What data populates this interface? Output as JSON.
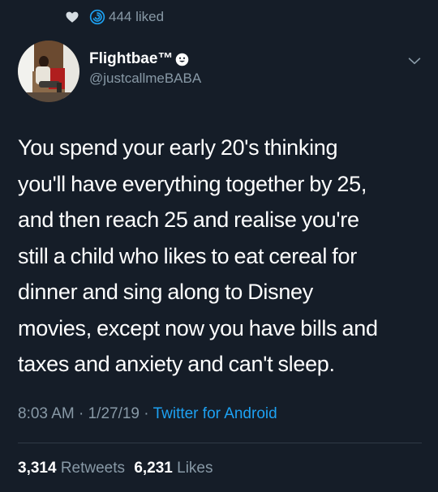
{
  "liked": {
    "count_label": "444 liked",
    "icons": [
      "heart-icon",
      "swirl-icon"
    ]
  },
  "author": {
    "display_name": "Flightbae™",
    "handle": "@justcallmeBABA",
    "avatar_icon": "avatar"
  },
  "tweet": {
    "lines": [
      "You spend your early 20's thinking",
      "you'll have everything together by 25,",
      "and then reach 25 and realise you're",
      "still a child who likes to eat cereal for",
      "dinner and sing along to Disney",
      "movies, except now you have bills and",
      "taxes and anxiety and can't sleep."
    ]
  },
  "meta": {
    "time": "8:03 AM",
    "separator": " · ",
    "date": "1/27/19",
    "source": "Twitter for Android"
  },
  "stats": {
    "retweets_count": "3,314",
    "retweets_label": "Retweets",
    "likes_count": "6,231",
    "likes_label": "Likes"
  },
  "colors": {
    "background": "#151d28",
    "text": "#ffffff",
    "muted": "#8899a6",
    "link": "#1da1f2",
    "divider": "#2f3a46"
  }
}
